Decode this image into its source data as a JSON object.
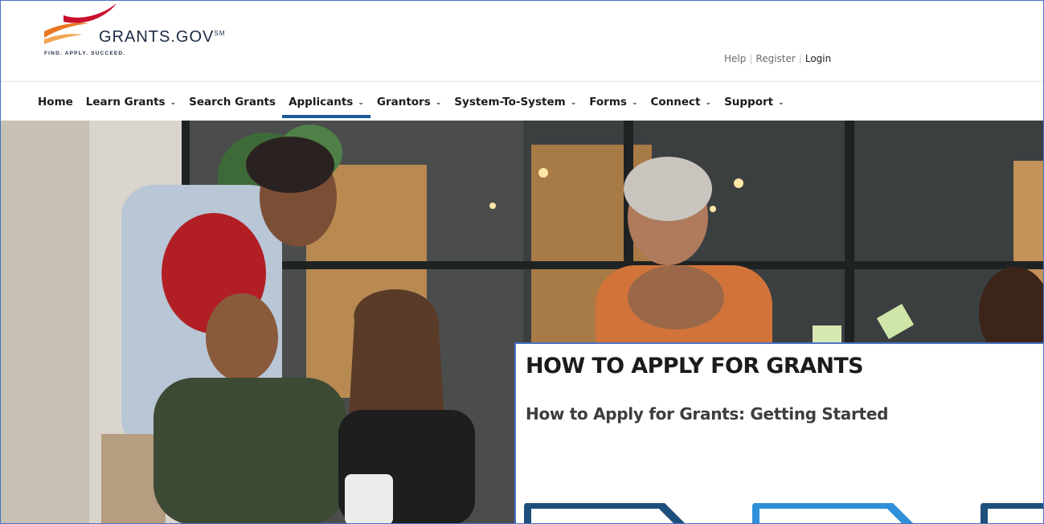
{
  "brand": {
    "name": "GRANTS.GOV",
    "mark": "SM",
    "tagline": "FIND. APPLY. SUCCEED."
  },
  "utility_links": {
    "help": "Help",
    "register": "Register",
    "login": "Login",
    "separator": "|"
  },
  "nav": {
    "items": [
      {
        "label": "Home",
        "has_dropdown": false,
        "active": false
      },
      {
        "label": "Learn Grants",
        "has_dropdown": true,
        "active": false
      },
      {
        "label": "Search Grants",
        "has_dropdown": false,
        "active": false
      },
      {
        "label": "Applicants",
        "has_dropdown": true,
        "active": true
      },
      {
        "label": "Grantors",
        "has_dropdown": true,
        "active": false
      },
      {
        "label": "System-To-System",
        "has_dropdown": true,
        "active": false
      },
      {
        "label": "Forms",
        "has_dropdown": true,
        "active": false
      },
      {
        "label": "Connect",
        "has_dropdown": true,
        "active": false
      },
      {
        "label": "Support",
        "has_dropdown": true,
        "active": false
      }
    ],
    "chevron": "⌄"
  },
  "card": {
    "title": "HOW TO APPLY FOR GRANTS",
    "subtitle": "How to Apply for Grants: Getting Started"
  },
  "colors": {
    "brand_orange": "#e87722",
    "brand_red": "#c8102e",
    "brand_navy": "#1b2a44",
    "active_underline": "#1a5a96",
    "tile_dark": "#1d4f7c",
    "tile_light": "#2f8fd8"
  }
}
